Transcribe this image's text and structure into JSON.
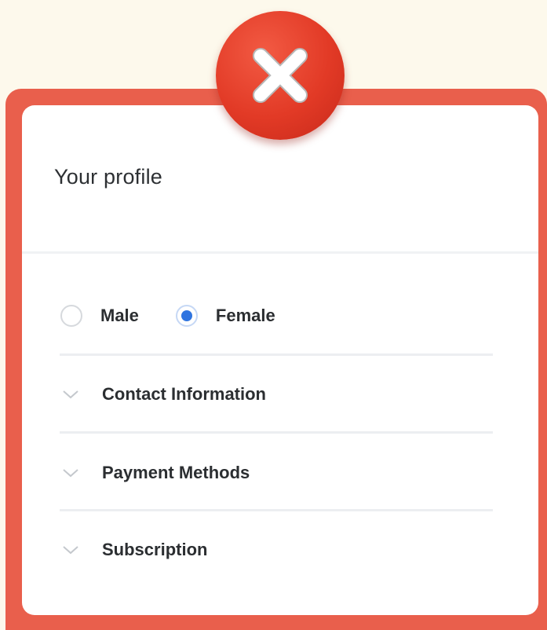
{
  "card": {
    "title": "Your profile"
  },
  "gender": {
    "options": [
      {
        "label": "Male",
        "selected": false
      },
      {
        "label": "Female",
        "selected": true
      }
    ]
  },
  "sections": [
    {
      "label": "Contact Information",
      "icon": "chevron-down-icon"
    },
    {
      "label": "Payment Methods",
      "icon": "chevron-down-icon"
    },
    {
      "label": "Subscription",
      "icon": "chevron-down-icon"
    }
  ],
  "badge": {
    "icon": "close-icon"
  },
  "colors": {
    "background": "#fdf9ec",
    "frame": "#e95f4c",
    "badge": "#e23a26",
    "radio_selected": "#2f74e0"
  }
}
